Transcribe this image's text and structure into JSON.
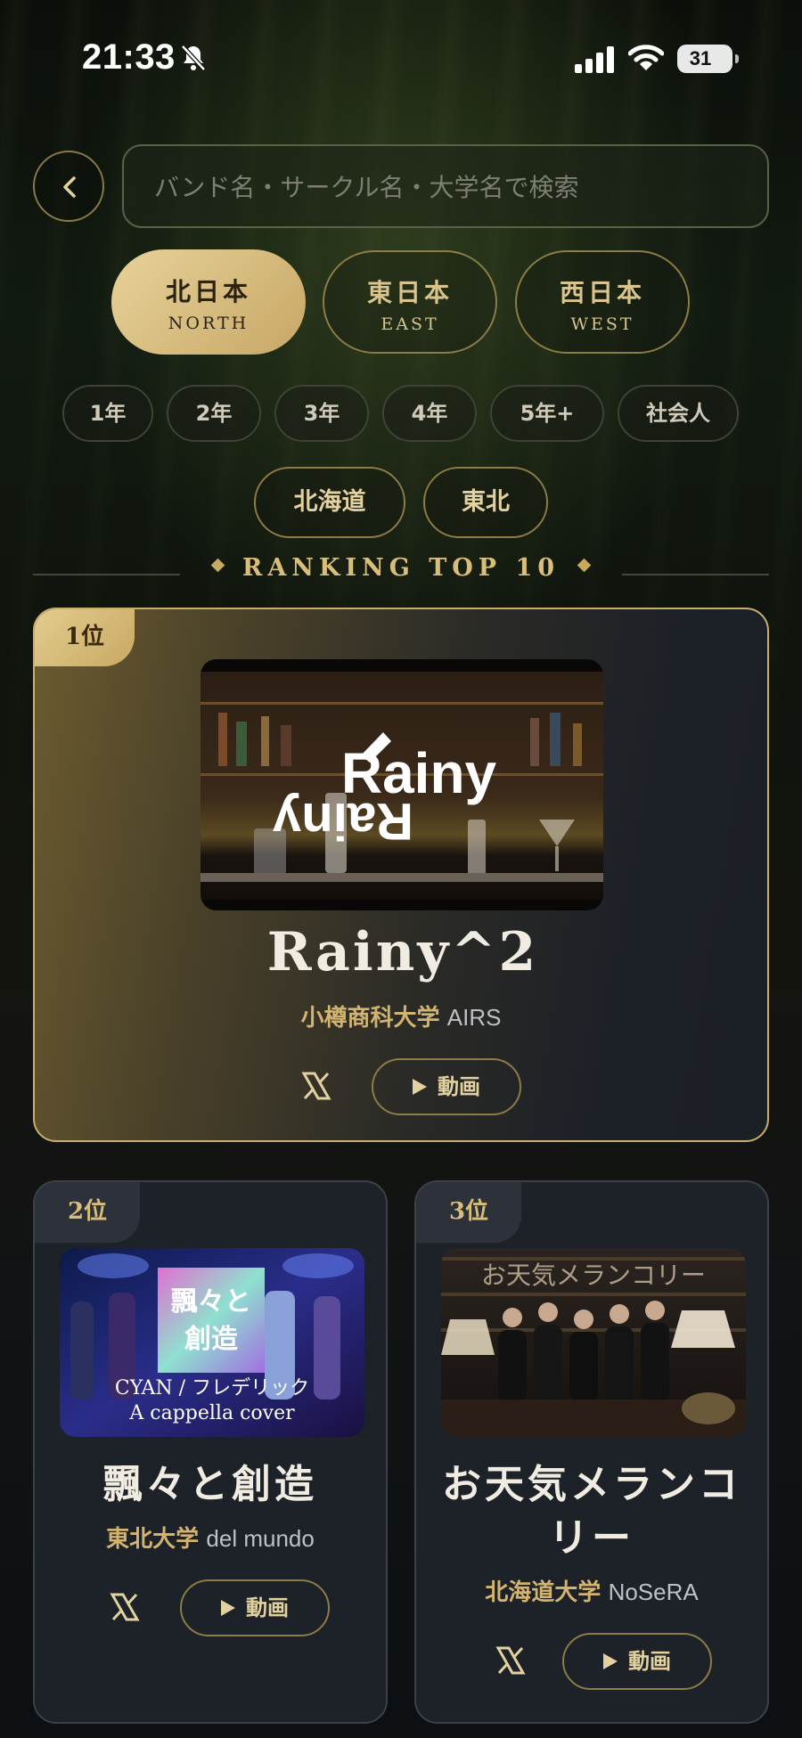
{
  "status_bar": {
    "time": "21:33",
    "battery": "31"
  },
  "search": {
    "placeholder": "バンド名・サークル名・大学名で検索"
  },
  "regions": [
    {
      "jp": "北日本",
      "en": "NORTH",
      "active": true
    },
    {
      "jp": "東日本",
      "en": "EAST",
      "active": false
    },
    {
      "jp": "西日本",
      "en": "WEST",
      "active": false
    }
  ],
  "years": [
    "1年",
    "2年",
    "3年",
    "4年",
    "5年+",
    "社会人"
  ],
  "areas": [
    "北海道",
    "東北"
  ],
  "ranking": {
    "title": "RANKING TOP 10"
  },
  "entries": [
    {
      "rank": "1位",
      "name": "Rainy^2",
      "university": "小樽商科大学",
      "group": "AIRS",
      "thumb_text": "Rainy",
      "video_label": "動画"
    },
    {
      "rank": "2位",
      "name": "飄々と創造",
      "university": "東北大学",
      "group": "del mundo",
      "thumb_title": "飄々と創造",
      "thumb_line1": "CYAN / フレデリック",
      "thumb_line2": "A cappella cover",
      "video_label": "動画"
    },
    {
      "rank": "3位",
      "name_line1": "お天気メランコ",
      "name_line2": "リー",
      "university": "北海道大学",
      "group": "NoSeRA",
      "thumb_text": "お天気メランコリー",
      "video_label": "動画"
    }
  ],
  "colors": {
    "gold": "#c8ad6c",
    "gold_light": "#e7d29a",
    "card_bg": "#1d2128"
  }
}
